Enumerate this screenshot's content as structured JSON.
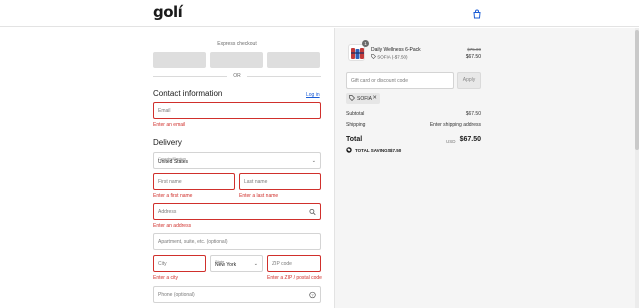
{
  "brand": {
    "logo_text": "golí"
  },
  "header": {
    "cart_icon": "shopping-bag-icon"
  },
  "express": {
    "title": "Express checkout",
    "or_text": "OR"
  },
  "contact": {
    "title": "Contact information",
    "login_label": "Log in",
    "email_placeholder": "Email",
    "email_error": "Enter an email"
  },
  "delivery": {
    "title": "Delivery",
    "country_label": "Country/Region",
    "country_value": "United States",
    "first_name_placeholder": "First name",
    "first_name_error": "Enter a first name",
    "last_name_placeholder": "Last name",
    "last_name_error": "Enter a last name",
    "address_placeholder": "Address",
    "address_error": "Enter an address",
    "apartment_placeholder": "Apartment, suite, etc. (optional)",
    "city_placeholder": "City",
    "city_error": "Enter a city",
    "state_label": "State",
    "state_value": "New York",
    "zip_placeholder": "ZIP code",
    "zip_error": "Enter a ZIP / postal code",
    "phone_placeholder": "Phone (optional)"
  },
  "summary": {
    "product": {
      "name": "Daily Wellness 6-Pack",
      "quantity_badge": "1",
      "discount_line": "SOFIA (-$7.50)",
      "price_original": "$75.00",
      "price_final": "$67.50"
    },
    "discount_placeholder": "Gift card or discount code",
    "apply_label": "Apply",
    "applied_code": "SOFIA",
    "subtotal_label": "Subtotal",
    "subtotal_value": "$67.50",
    "shipping_label": "Shipping",
    "shipping_value": "Enter shipping address",
    "total_label": "Total",
    "total_currency": "USD",
    "total_value": "$67.50",
    "savings_label": "TOTAL SAVINGS",
    "savings_value": "$7.50"
  },
  "colors": {
    "error": "#d0302c",
    "link": "#1a5cd6",
    "summary_bg": "#f5f5f5"
  }
}
